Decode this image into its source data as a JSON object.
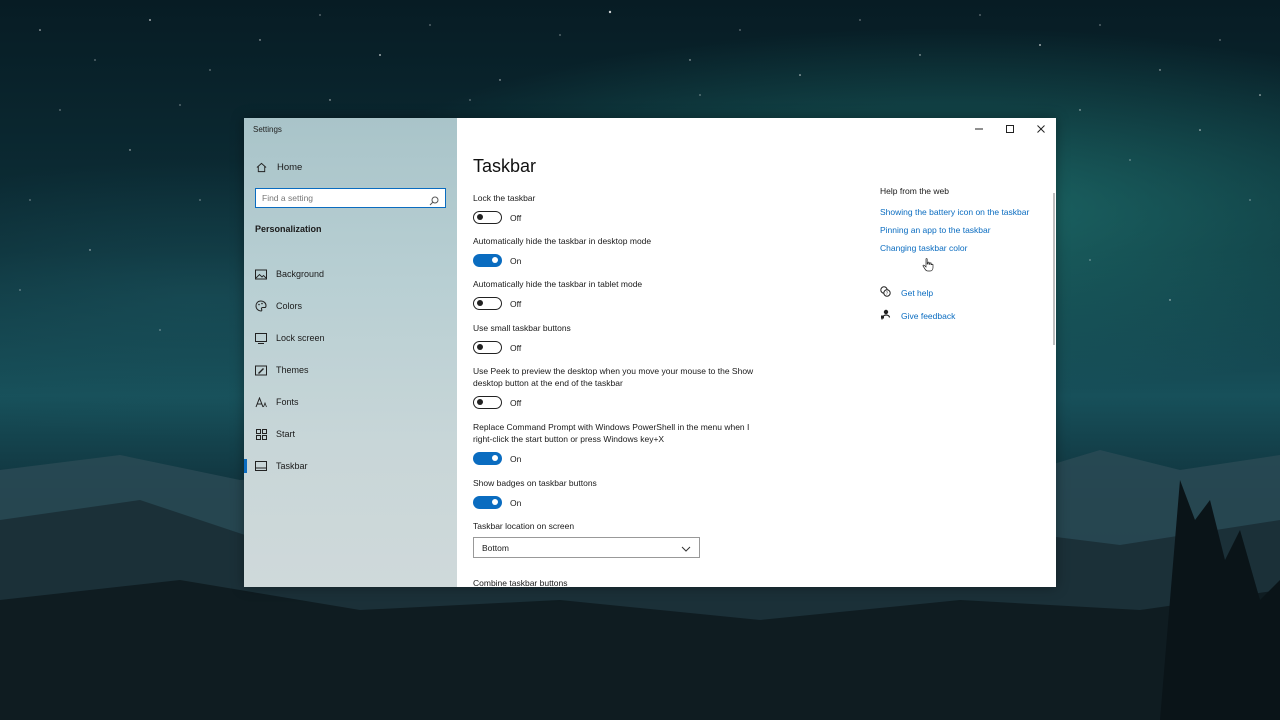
{
  "window": {
    "title": "Settings",
    "caption": {
      "minimize": "—",
      "maximize": "☐",
      "close": "✕"
    }
  },
  "nav": {
    "home_label": "Home",
    "search_placeholder": "Find a setting",
    "section_heading": "Personalization",
    "items": [
      {
        "label": "Background",
        "icon": "background-icon"
      },
      {
        "label": "Colors",
        "icon": "colors-icon"
      },
      {
        "label": "Lock screen",
        "icon": "lock-screen-icon"
      },
      {
        "label": "Themes",
        "icon": "themes-icon"
      },
      {
        "label": "Fonts",
        "icon": "fonts-icon"
      },
      {
        "label": "Start",
        "icon": "start-icon"
      },
      {
        "label": "Taskbar",
        "icon": "taskbar-icon",
        "active": true
      }
    ]
  },
  "main": {
    "title": "Taskbar",
    "settings": [
      {
        "label": "Lock the taskbar",
        "state": "Off",
        "on": false
      },
      {
        "label": "Automatically hide the taskbar in desktop mode",
        "state": "On",
        "on": true
      },
      {
        "label": "Automatically hide the taskbar in tablet mode",
        "state": "Off",
        "on": false
      },
      {
        "label": "Use small taskbar buttons",
        "state": "Off",
        "on": false
      },
      {
        "label": "Use Peek to preview the desktop when you move your mouse to the Show desktop button at the end of the taskbar",
        "state": "Off",
        "on": false
      },
      {
        "label": "Replace Command Prompt with Windows PowerShell in the menu when I right-click the start button or press Windows key+X",
        "state": "On",
        "on": true
      },
      {
        "label": "Show badges on taskbar buttons",
        "state": "On",
        "on": true
      }
    ],
    "location": {
      "label": "Taskbar location on screen",
      "value": "Bottom"
    },
    "combine_label": "Combine taskbar buttons"
  },
  "help": {
    "title": "Help from the web",
    "links": [
      "Showing the battery icon on the taskbar",
      "Pinning an app to the taskbar",
      "Changing taskbar color"
    ],
    "get_help": "Get help",
    "give_feedback": "Give feedback"
  },
  "colors": {
    "accent": "#0a6cc0"
  }
}
